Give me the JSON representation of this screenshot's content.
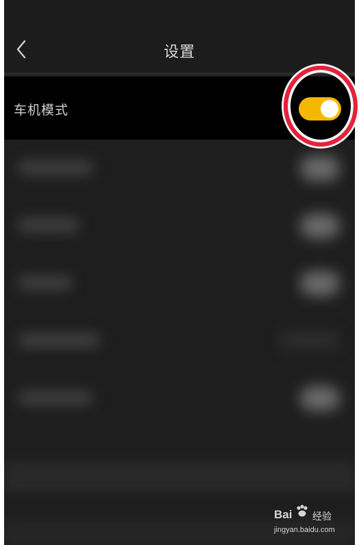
{
  "header": {
    "title": "设置",
    "back_icon": "chevron-left-icon"
  },
  "settings": {
    "car_mode": {
      "label": "车机模式",
      "toggle_on": true,
      "toggle_color": "#f5b800"
    }
  },
  "annotation": {
    "highlight_color": "#e8203a"
  },
  "watermark": {
    "brand_prefix": "Bai",
    "brand_suffix": "经验",
    "url": "jingyan.baidu.com"
  }
}
